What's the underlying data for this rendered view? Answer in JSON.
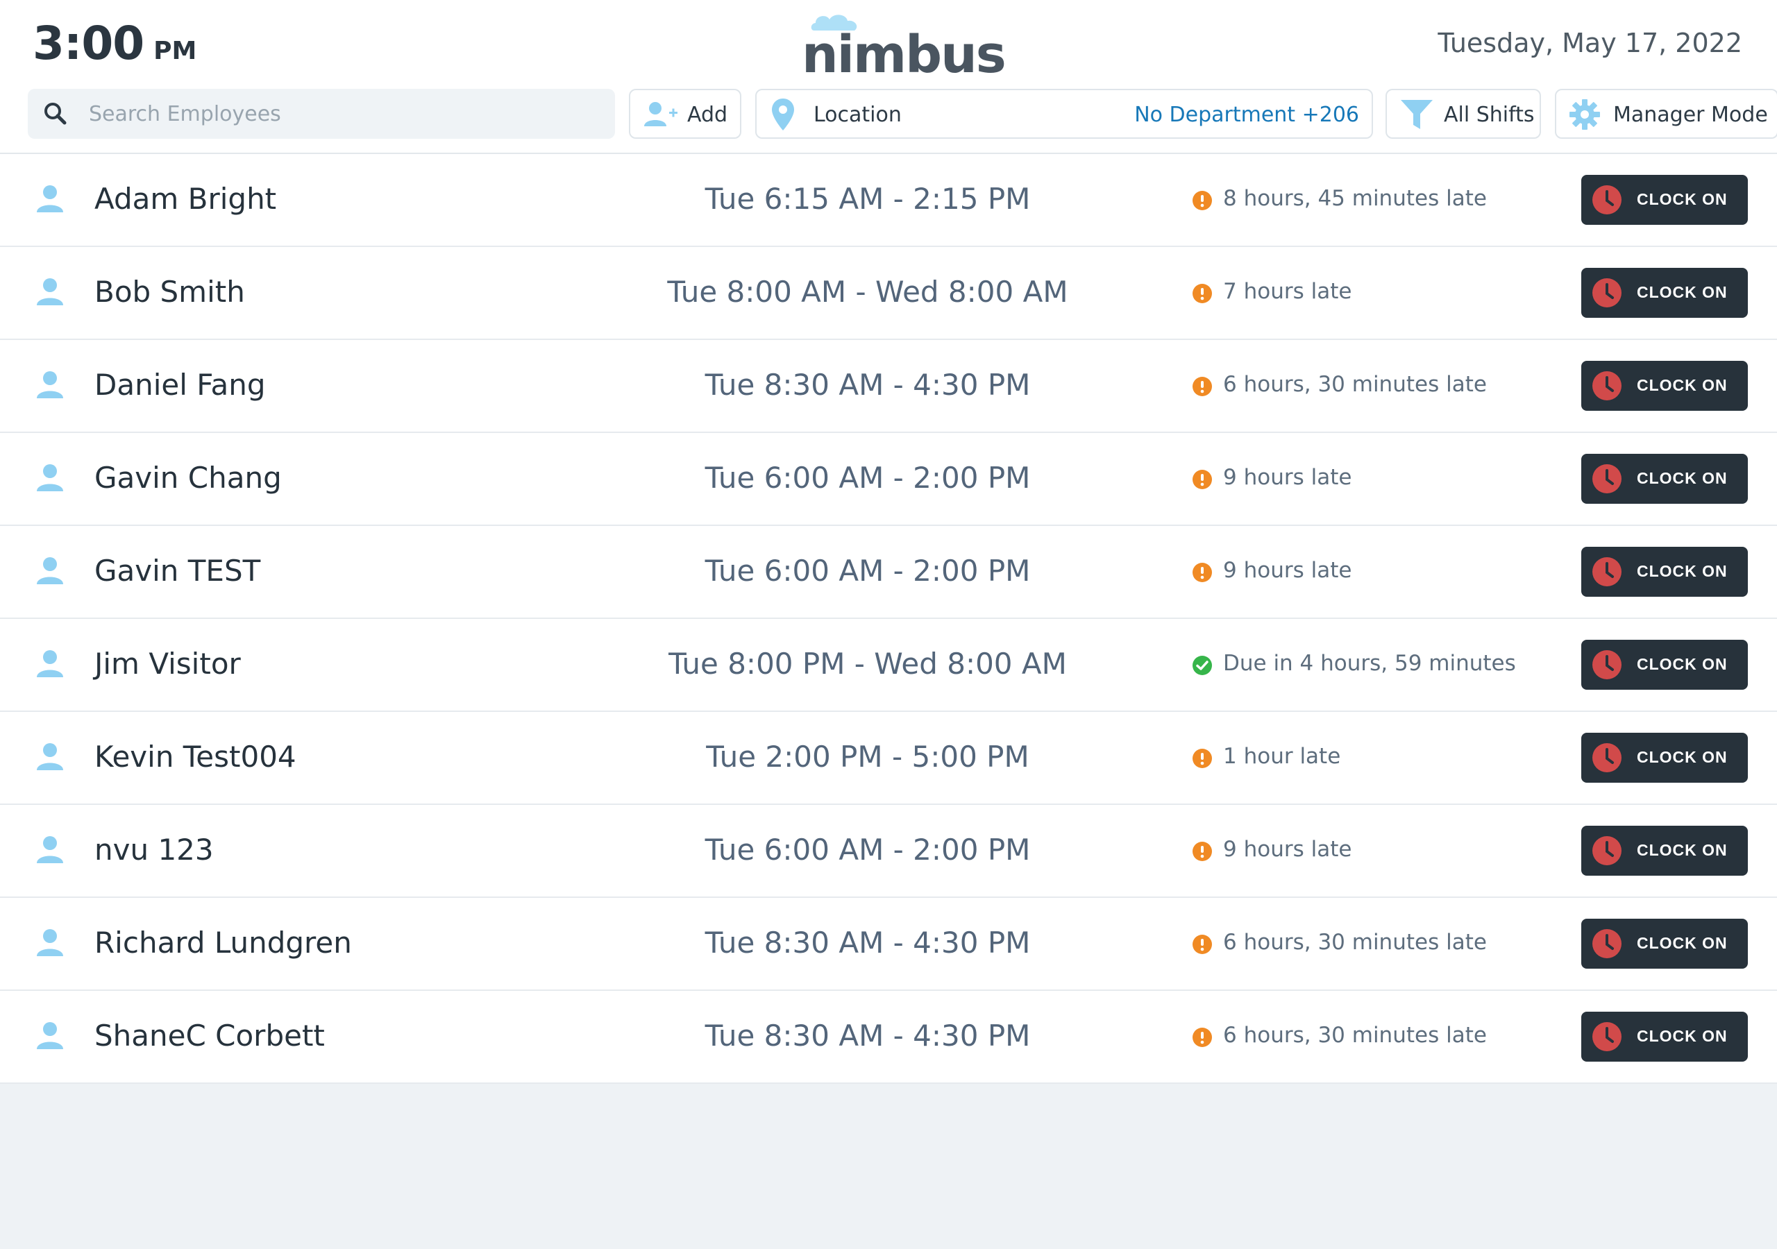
{
  "header": {
    "time": "3:00",
    "ampm": "PM",
    "logo_text": "nimbus",
    "date": "Tuesday, May 17, 2022"
  },
  "toolbar": {
    "search_placeholder": "Search Employees",
    "add_label": "Add",
    "location_label": "Location",
    "department_label": "No Department +206",
    "shifts_label": "All Shifts",
    "manager_label": "Manager Mode"
  },
  "colors": {
    "accent_blue": "#1778b8",
    "icon_blue": "#8fd0f2",
    "late_orange": "#f08a24",
    "due_green": "#36b54a",
    "clock_button": "#27323b",
    "clock_icon_red": "#d14a4a"
  },
  "clock_on_label": "CLOCK ON",
  "employees": [
    {
      "name": "Adam Bright",
      "shift": "Tue 6:15 AM - 2:15 PM",
      "status": "8 hours, 45 minutes late",
      "status_type": "late"
    },
    {
      "name": "Bob Smith",
      "shift": "Tue 8:00 AM - Wed 8:00 AM",
      "status": "7 hours late",
      "status_type": "late"
    },
    {
      "name": "Daniel Fang",
      "shift": "Tue 8:30 AM - 4:30 PM",
      "status": "6 hours, 30 minutes late",
      "status_type": "late"
    },
    {
      "name": "Gavin Chang",
      "shift": "Tue 6:00 AM - 2:00 PM",
      "status": "9 hours late",
      "status_type": "late"
    },
    {
      "name": "Gavin TEST",
      "shift": "Tue 6:00 AM - 2:00 PM",
      "status": "9 hours late",
      "status_type": "late"
    },
    {
      "name": "Jim Visitor",
      "shift": "Tue 8:00 PM - Wed 8:00 AM",
      "status": "Due in 4 hours, 59 minutes",
      "status_type": "due"
    },
    {
      "name": "Kevin Test004",
      "shift": "Tue 2:00 PM - 5:00 PM",
      "status": "1 hour late",
      "status_type": "late"
    },
    {
      "name": "nvu 123",
      "shift": "Tue 6:00 AM - 2:00 PM",
      "status": "9 hours late",
      "status_type": "late"
    },
    {
      "name": "Richard Lundgren",
      "shift": "Tue 8:30 AM - 4:30 PM",
      "status": "6 hours, 30 minutes late",
      "status_type": "late"
    },
    {
      "name": "ShaneC Corbett",
      "shift": "Tue 8:30 AM - 4:30 PM",
      "status": "6 hours, 30 minutes late",
      "status_type": "late"
    }
  ]
}
